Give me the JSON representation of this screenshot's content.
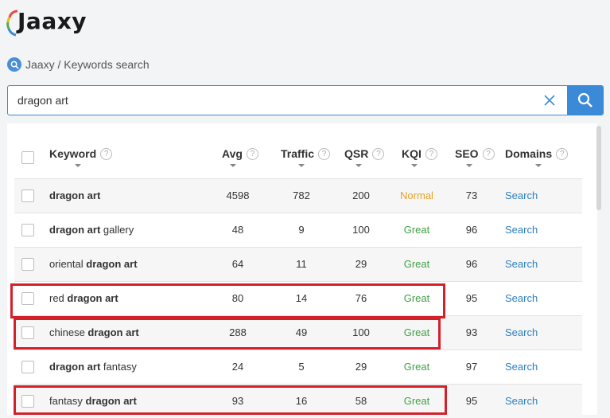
{
  "app": {
    "logo_text": "Jaaxy"
  },
  "breadcrumb": {
    "text": "Jaaxy / Keywords search"
  },
  "search": {
    "value": "dragon art"
  },
  "table": {
    "columns": [
      "Keyword",
      "Avg",
      "Traffic",
      "QSR",
      "KQI",
      "SEO",
      "Domains"
    ],
    "rows": [
      {
        "keyword_html": "<b>dragon art</b>",
        "avg": "4598",
        "traffic": "782",
        "qsr": "200",
        "kqi": "Normal",
        "seo": "73",
        "domains": "Search"
      },
      {
        "keyword_html": "<b>dragon art</b> gallery",
        "avg": "48",
        "traffic": "9",
        "qsr": "100",
        "kqi": "Great",
        "seo": "96",
        "domains": "Search"
      },
      {
        "keyword_html": "oriental <b>dragon art</b>",
        "avg": "64",
        "traffic": "11",
        "qsr": "29",
        "kqi": "Great",
        "seo": "96",
        "domains": "Search"
      },
      {
        "keyword_html": "red <b>dragon art</b>",
        "avg": "80",
        "traffic": "14",
        "qsr": "76",
        "kqi": "Great",
        "seo": "95",
        "domains": "Search"
      },
      {
        "keyword_html": "chinese <b>dragon art</b>",
        "avg": "288",
        "traffic": "49",
        "qsr": "100",
        "kqi": "Great",
        "seo": "93",
        "domains": "Search"
      },
      {
        "keyword_html": "<b>dragon art</b> fantasy",
        "avg": "24",
        "traffic": "5",
        "qsr": "29",
        "kqi": "Great",
        "seo": "97",
        "domains": "Search"
      },
      {
        "keyword_html": "fantasy <b>dragon art</b>",
        "avg": "93",
        "traffic": "16",
        "qsr": "58",
        "kqi": "Great",
        "seo": "95",
        "domains": "Search"
      }
    ]
  },
  "colors": {
    "accent": "#3b8ad8",
    "highlight": "#d3212c",
    "kqi_normal": "#e6a22b",
    "kqi_great": "#43a047",
    "link": "#2f7fc0"
  },
  "icons": {
    "breadcrumb": "search-icon",
    "clear": "close-icon",
    "submit": "search-icon",
    "help": "help-icon",
    "sort": "caret-down-icon"
  }
}
